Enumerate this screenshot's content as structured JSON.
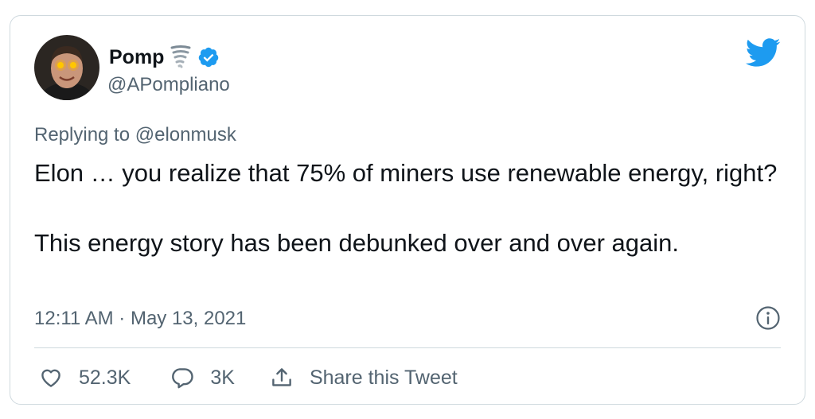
{
  "tweet": {
    "display_name": "Pomp",
    "handle": "@APompliano",
    "replying_prefix": "Replying to",
    "replying_to": "@elonmusk",
    "text_line1": "Elon … you realize that 75% of miners use renewable energy, right?",
    "text_line2": "This energy story has been debunked over and over again.",
    "timestamp": "12:11 AM · May 13, 2021"
  },
  "actions": {
    "likes": "52.3K",
    "replies": "3K",
    "share_label": "Share this Tweet"
  },
  "icons": {
    "verified": "verified-badge-icon",
    "tornado": "tornado-emoji-icon",
    "logo": "twitter-bird-icon",
    "info": "info-icon",
    "heart": "heart-icon",
    "reply": "reply-bubble-icon",
    "share": "share-icon"
  },
  "colors": {
    "twitter_blue": "#1d9bf0",
    "text_primary": "#0f1419",
    "text_secondary": "#536471",
    "border": "#cfd9de"
  }
}
